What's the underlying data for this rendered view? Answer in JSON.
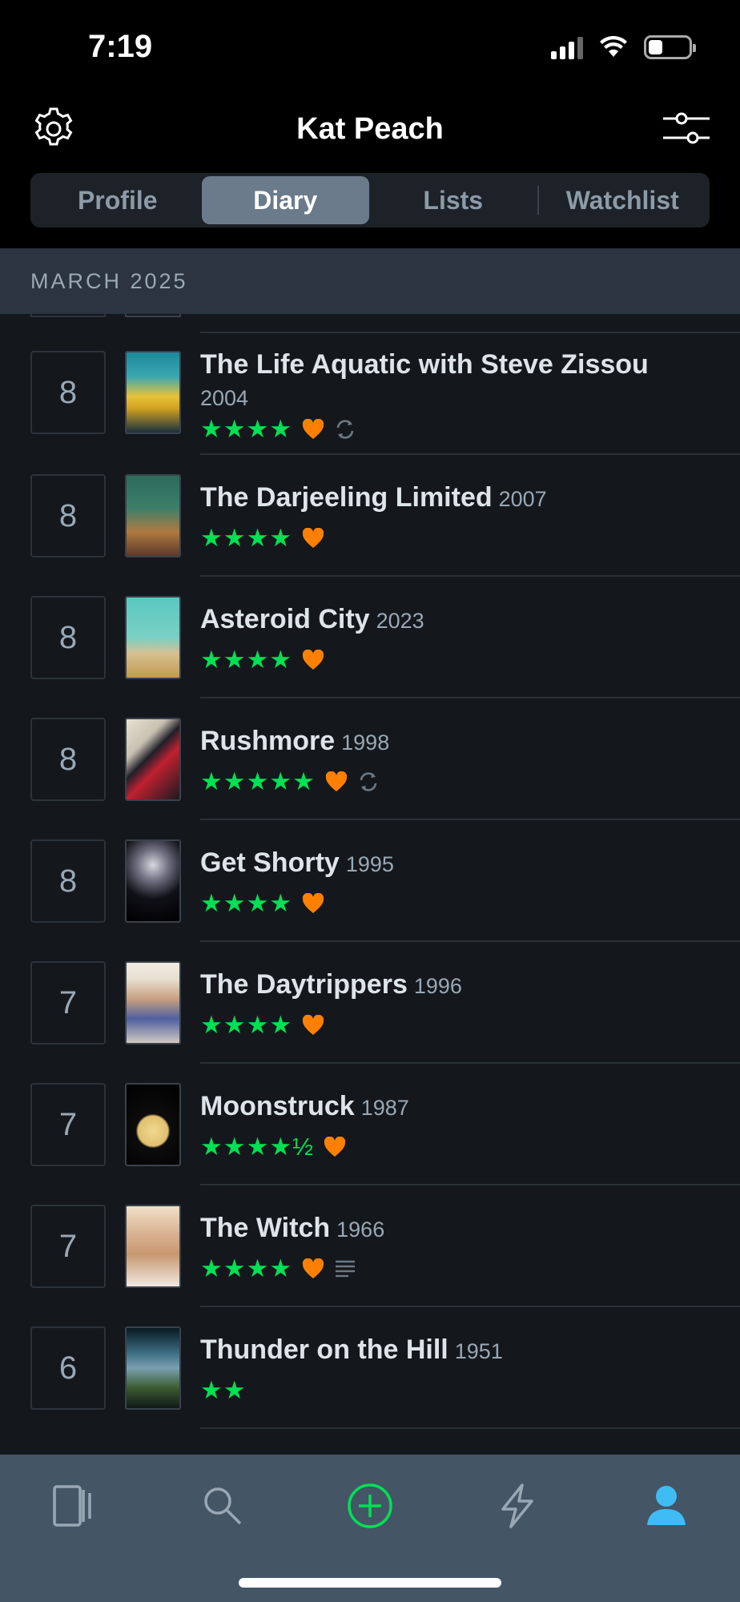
{
  "status_bar": {
    "time": "7:19"
  },
  "header": {
    "title": "Kat Peach",
    "tabs": [
      {
        "label": "Profile",
        "active": false
      },
      {
        "label": "Diary",
        "active": true
      },
      {
        "label": "Lists",
        "active": false
      },
      {
        "label": "Watchlist",
        "active": false
      }
    ]
  },
  "section": {
    "title": "MARCH 2025"
  },
  "entries": [
    {
      "day": "8",
      "title": "The Life Aquatic with Steve Zissou",
      "year": "2004",
      "stars": "★★★★",
      "liked": true,
      "rewatch": true,
      "review": false
    },
    {
      "day": "8",
      "title": "The Darjeeling Limited",
      "year": "2007",
      "stars": "★★★★",
      "liked": true,
      "rewatch": false,
      "review": false
    },
    {
      "day": "8",
      "title": "Asteroid City",
      "year": "2023",
      "stars": "★★★★",
      "liked": true,
      "rewatch": false,
      "review": false
    },
    {
      "day": "8",
      "title": "Rushmore",
      "year": "1998",
      "stars": "★★★★★",
      "liked": true,
      "rewatch": true,
      "review": false
    },
    {
      "day": "8",
      "title": "Get Shorty",
      "year": "1995",
      "stars": "★★★★",
      "liked": true,
      "rewatch": false,
      "review": false
    },
    {
      "day": "7",
      "title": "The Daytrippers",
      "year": "1996",
      "stars": "★★★★",
      "liked": true,
      "rewatch": false,
      "review": false
    },
    {
      "day": "7",
      "title": "Moonstruck",
      "year": "1987",
      "stars": "★★★★½",
      "liked": true,
      "rewatch": false,
      "review": false
    },
    {
      "day": "7",
      "title": "The Witch",
      "year": "1966",
      "stars": "★★★★",
      "liked": true,
      "rewatch": false,
      "review": true
    },
    {
      "day": "6",
      "title": "Thunder on the Hill",
      "year": "1951",
      "stars": "★★",
      "liked": false,
      "rewatch": false,
      "review": false
    }
  ],
  "tabbar": {
    "items": [
      {
        "icon": "films-icon"
      },
      {
        "icon": "search-icon"
      },
      {
        "icon": "add-icon"
      },
      {
        "icon": "activity-icon"
      },
      {
        "icon": "profile-icon"
      }
    ]
  },
  "colors": {
    "accent_green": "#00e054",
    "heart_orange": "#ff8000",
    "profile_blue": "#40bcf4"
  }
}
